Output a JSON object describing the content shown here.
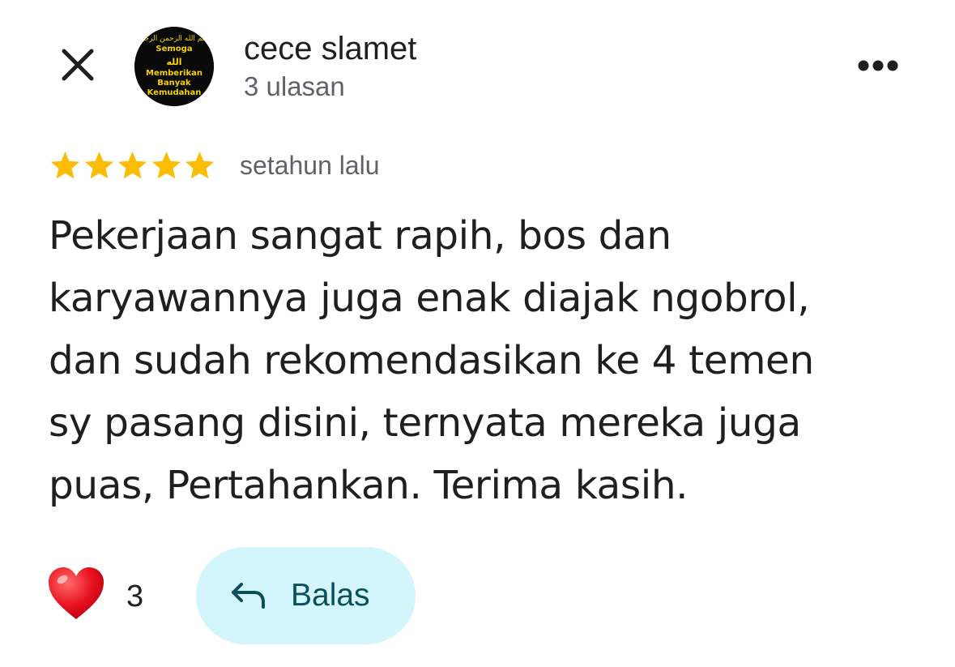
{
  "reviewer": {
    "name": "cece slamet",
    "meta": "3 ulasan",
    "avatar_lines": [
      "Semoga",
      "الله",
      "Memberikan",
      "Banyak",
      "Kemudahan"
    ],
    "avatar_arabic": "بسم الله الرحمن الرحيم"
  },
  "review": {
    "rating": 5,
    "rating_max": 5,
    "time_ago": "setahun lalu",
    "text_lines": [
      "Pekerjaan sangat rapih, bos dan",
      "karyawannya juga enak diajak ngobrol,",
      "dan sudah rekomendasikan ke 4 temen",
      "sy pasang disini, ternyata mereka juga",
      "puas, Pertahankan. Terima kasih."
    ]
  },
  "actions": {
    "like_emoji": "❤️",
    "like_count": "3",
    "reply_label": "Balas"
  },
  "icons": {
    "close": "close-icon",
    "more": "more-vert-icon",
    "star": "star-icon",
    "reply": "reply-arrow-icon",
    "heart": "heart-icon"
  },
  "colors": {
    "star": "#fbbc04",
    "secondary_text": "#5f6368",
    "primary_text": "#1f1f1f",
    "reply_bg": "#d3f5fc",
    "reply_text": "#0b4f5c",
    "avatar_text": "#f5d300"
  }
}
